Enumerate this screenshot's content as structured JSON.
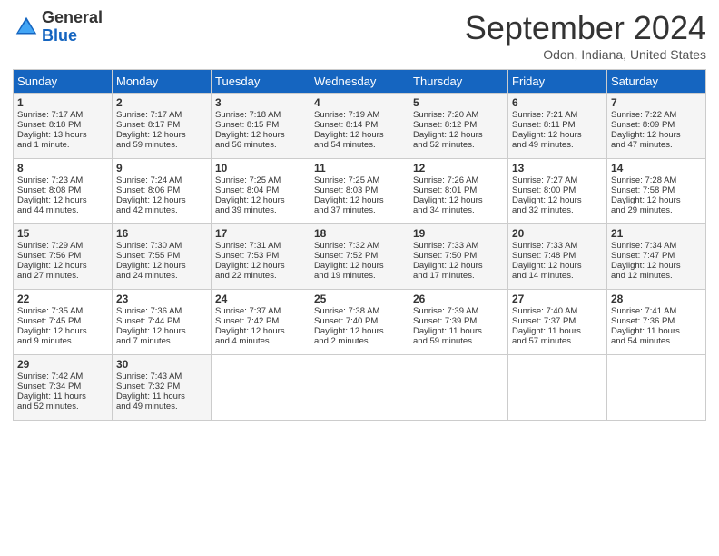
{
  "logo": {
    "general": "General",
    "blue": "Blue"
  },
  "title": "September 2024",
  "subtitle": "Odon, Indiana, United States",
  "days_of_week": [
    "Sunday",
    "Monday",
    "Tuesday",
    "Wednesday",
    "Thursday",
    "Friday",
    "Saturday"
  ],
  "weeks": [
    [
      {
        "day": "1",
        "lines": [
          "Sunrise: 7:17 AM",
          "Sunset: 8:18 PM",
          "Daylight: 13 hours",
          "and 1 minute."
        ]
      },
      {
        "day": "2",
        "lines": [
          "Sunrise: 7:17 AM",
          "Sunset: 8:17 PM",
          "Daylight: 12 hours",
          "and 59 minutes."
        ]
      },
      {
        "day": "3",
        "lines": [
          "Sunrise: 7:18 AM",
          "Sunset: 8:15 PM",
          "Daylight: 12 hours",
          "and 56 minutes."
        ]
      },
      {
        "day": "4",
        "lines": [
          "Sunrise: 7:19 AM",
          "Sunset: 8:14 PM",
          "Daylight: 12 hours",
          "and 54 minutes."
        ]
      },
      {
        "day": "5",
        "lines": [
          "Sunrise: 7:20 AM",
          "Sunset: 8:12 PM",
          "Daylight: 12 hours",
          "and 52 minutes."
        ]
      },
      {
        "day": "6",
        "lines": [
          "Sunrise: 7:21 AM",
          "Sunset: 8:11 PM",
          "Daylight: 12 hours",
          "and 49 minutes."
        ]
      },
      {
        "day": "7",
        "lines": [
          "Sunrise: 7:22 AM",
          "Sunset: 8:09 PM",
          "Daylight: 12 hours",
          "and 47 minutes."
        ]
      }
    ],
    [
      {
        "day": "8",
        "lines": [
          "Sunrise: 7:23 AM",
          "Sunset: 8:08 PM",
          "Daylight: 12 hours",
          "and 44 minutes."
        ]
      },
      {
        "day": "9",
        "lines": [
          "Sunrise: 7:24 AM",
          "Sunset: 8:06 PM",
          "Daylight: 12 hours",
          "and 42 minutes."
        ]
      },
      {
        "day": "10",
        "lines": [
          "Sunrise: 7:25 AM",
          "Sunset: 8:04 PM",
          "Daylight: 12 hours",
          "and 39 minutes."
        ]
      },
      {
        "day": "11",
        "lines": [
          "Sunrise: 7:25 AM",
          "Sunset: 8:03 PM",
          "Daylight: 12 hours",
          "and 37 minutes."
        ]
      },
      {
        "day": "12",
        "lines": [
          "Sunrise: 7:26 AM",
          "Sunset: 8:01 PM",
          "Daylight: 12 hours",
          "and 34 minutes."
        ]
      },
      {
        "day": "13",
        "lines": [
          "Sunrise: 7:27 AM",
          "Sunset: 8:00 PM",
          "Daylight: 12 hours",
          "and 32 minutes."
        ]
      },
      {
        "day": "14",
        "lines": [
          "Sunrise: 7:28 AM",
          "Sunset: 7:58 PM",
          "Daylight: 12 hours",
          "and 29 minutes."
        ]
      }
    ],
    [
      {
        "day": "15",
        "lines": [
          "Sunrise: 7:29 AM",
          "Sunset: 7:56 PM",
          "Daylight: 12 hours",
          "and 27 minutes."
        ]
      },
      {
        "day": "16",
        "lines": [
          "Sunrise: 7:30 AM",
          "Sunset: 7:55 PM",
          "Daylight: 12 hours",
          "and 24 minutes."
        ]
      },
      {
        "day": "17",
        "lines": [
          "Sunrise: 7:31 AM",
          "Sunset: 7:53 PM",
          "Daylight: 12 hours",
          "and 22 minutes."
        ]
      },
      {
        "day": "18",
        "lines": [
          "Sunrise: 7:32 AM",
          "Sunset: 7:52 PM",
          "Daylight: 12 hours",
          "and 19 minutes."
        ]
      },
      {
        "day": "19",
        "lines": [
          "Sunrise: 7:33 AM",
          "Sunset: 7:50 PM",
          "Daylight: 12 hours",
          "and 17 minutes."
        ]
      },
      {
        "day": "20",
        "lines": [
          "Sunrise: 7:33 AM",
          "Sunset: 7:48 PM",
          "Daylight: 12 hours",
          "and 14 minutes."
        ]
      },
      {
        "day": "21",
        "lines": [
          "Sunrise: 7:34 AM",
          "Sunset: 7:47 PM",
          "Daylight: 12 hours",
          "and 12 minutes."
        ]
      }
    ],
    [
      {
        "day": "22",
        "lines": [
          "Sunrise: 7:35 AM",
          "Sunset: 7:45 PM",
          "Daylight: 12 hours",
          "and 9 minutes."
        ]
      },
      {
        "day": "23",
        "lines": [
          "Sunrise: 7:36 AM",
          "Sunset: 7:44 PM",
          "Daylight: 12 hours",
          "and 7 minutes."
        ]
      },
      {
        "day": "24",
        "lines": [
          "Sunrise: 7:37 AM",
          "Sunset: 7:42 PM",
          "Daylight: 12 hours",
          "and 4 minutes."
        ]
      },
      {
        "day": "25",
        "lines": [
          "Sunrise: 7:38 AM",
          "Sunset: 7:40 PM",
          "Daylight: 12 hours",
          "and 2 minutes."
        ]
      },
      {
        "day": "26",
        "lines": [
          "Sunrise: 7:39 AM",
          "Sunset: 7:39 PM",
          "Daylight: 11 hours",
          "and 59 minutes."
        ]
      },
      {
        "day": "27",
        "lines": [
          "Sunrise: 7:40 AM",
          "Sunset: 7:37 PM",
          "Daylight: 11 hours",
          "and 57 minutes."
        ]
      },
      {
        "day": "28",
        "lines": [
          "Sunrise: 7:41 AM",
          "Sunset: 7:36 PM",
          "Daylight: 11 hours",
          "and 54 minutes."
        ]
      }
    ],
    [
      {
        "day": "29",
        "lines": [
          "Sunrise: 7:42 AM",
          "Sunset: 7:34 PM",
          "Daylight: 11 hours",
          "and 52 minutes."
        ]
      },
      {
        "day": "30",
        "lines": [
          "Sunrise: 7:43 AM",
          "Sunset: 7:32 PM",
          "Daylight: 11 hours",
          "and 49 minutes."
        ]
      },
      null,
      null,
      null,
      null,
      null
    ]
  ]
}
